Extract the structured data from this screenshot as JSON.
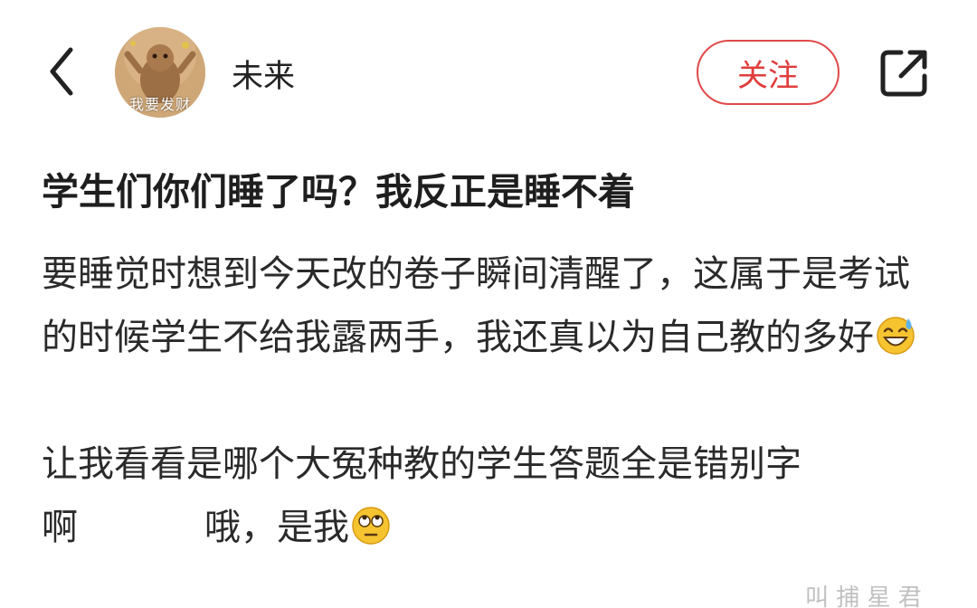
{
  "header": {
    "avatar_caption": "我要发财",
    "username": "未来",
    "follow_label": "关注"
  },
  "post": {
    "title": "学生们你们睡了吗？我反正是睡不着",
    "paragraph1": "要睡觉时想到今天改的卷子瞬间清醒了，这属于是考试的时候学生不给我露两手，我还真以为自己教的多好",
    "paragraph2": "让我看看是哪个大冤种教的学生答题全是错别字",
    "paragraph3_a": "啊",
    "paragraph3_b": "哦，是我"
  },
  "watermark": "叫 捕 星 君",
  "icons": {
    "back": "chevron-left-icon",
    "share": "share-external-icon",
    "emoji1": "grinning-sweat-emoji",
    "emoji2": "eye-roll-emoji"
  },
  "colors": {
    "accent": "#e03c3c",
    "text": "#1e1e1e"
  }
}
